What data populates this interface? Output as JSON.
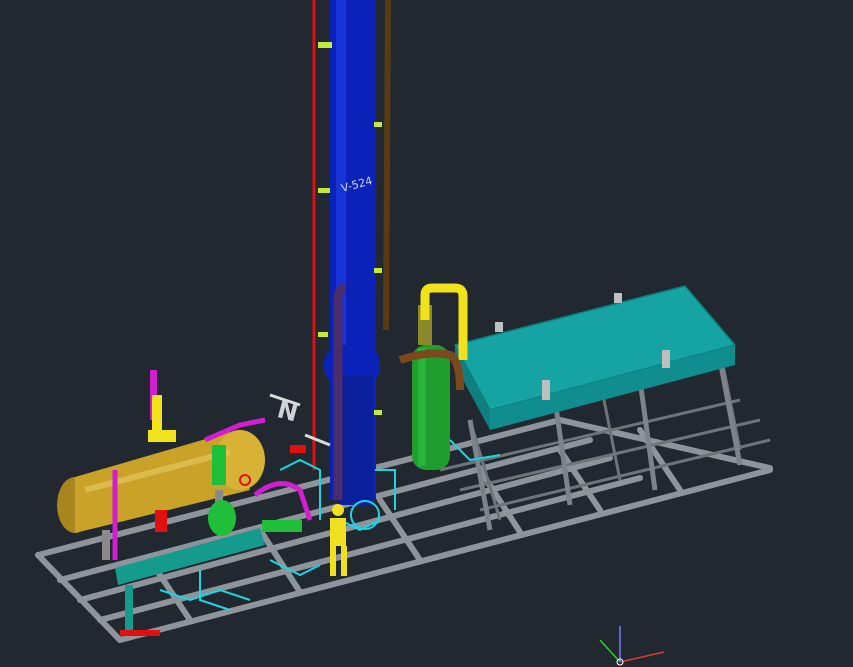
{
  "scene": {
    "colors": {
      "background": "#212830",
      "column": "#0b22b8",
      "vessel_gold": "#c9a227",
      "vessel_green": "#1f9e2e",
      "cooler_teal": "#15a3a3",
      "skid_grey": "#8e9499",
      "pipe_yellow": "#f2e21b",
      "pipe_red": "#e01010",
      "pipe_magenta": "#d01ed0",
      "pipe_cyan": "#19d6e6"
    },
    "labels": {
      "column_tag": "V-524",
      "north_arrow": "N"
    },
    "ucs_icon": {
      "name": "ucs-icon"
    }
  }
}
